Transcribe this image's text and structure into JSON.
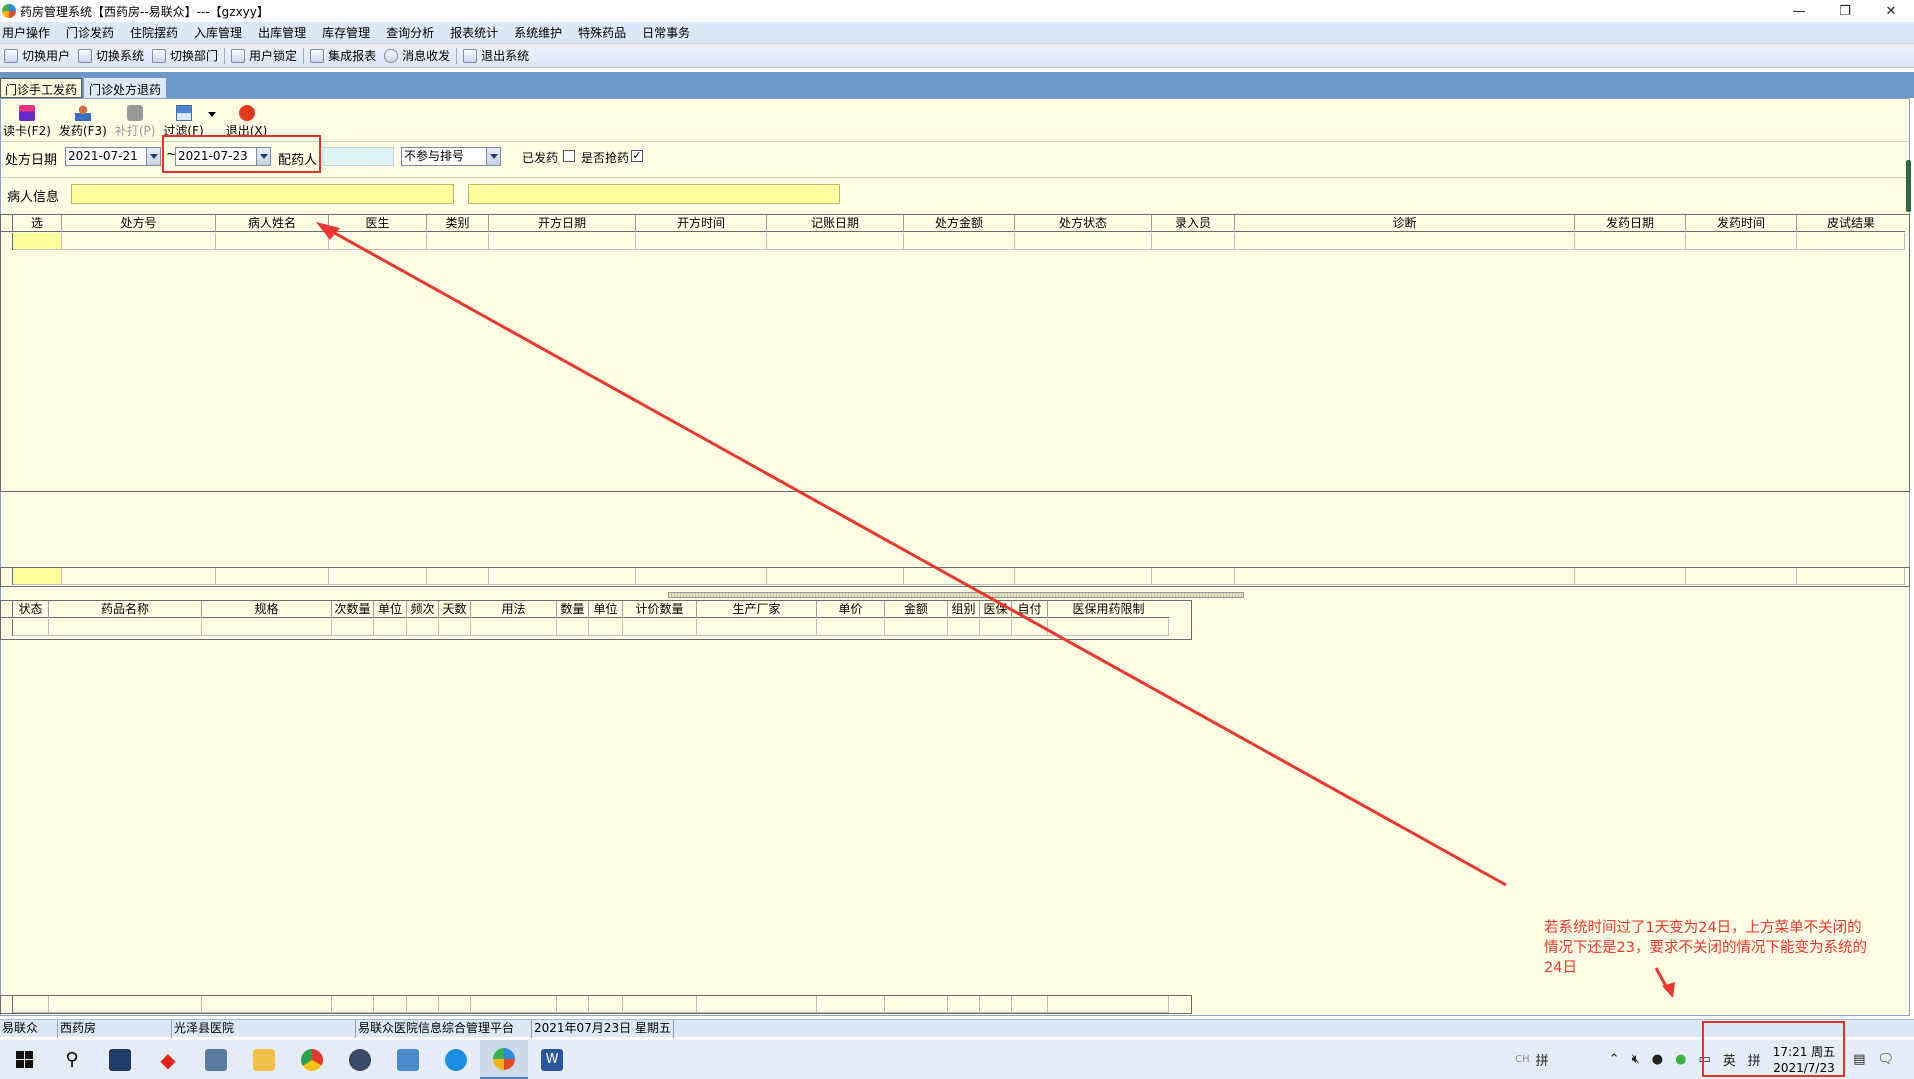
{
  "window": {
    "title": "药房管理系统【西药房--易联众】---【gzxyy】",
    "minimize_icon": "minimize-icon",
    "restore_icon": "restore-icon",
    "close_icon": "close-icon"
  },
  "menu": [
    "用户操作",
    "门诊发药",
    "住院摆药",
    "入库管理",
    "出库管理",
    "库存管理",
    "查询分析",
    "报表统计",
    "系统维护",
    "特殊药品",
    "日常事务"
  ],
  "toolbar": [
    "切换用户",
    "切换系统",
    "切换部门",
    "用户锁定",
    "集成报表",
    "消息收发",
    "退出系统"
  ],
  "tabs": [
    "门诊手工发药",
    "门诊处方退药"
  ],
  "actions": {
    "read_card": "读卡(F2)",
    "dispense": "发药(F3)",
    "reprint": "补打(P)",
    "filter": "过滤(F)",
    "exit": "退出(X)"
  },
  "filter": {
    "date_label": "处方日期",
    "date_from": "2021-07-21",
    "tilde": "~",
    "date_to": "2021-07-23",
    "pharmacist_label": "配药人",
    "queue_select": "不参与排号",
    "dispensed_label": "已发药",
    "dispensed_checked": false,
    "grab_label": "是否抢药",
    "grab_checked": true
  },
  "patient": {
    "label": "病人信息"
  },
  "rx_grid": {
    "columns": [
      "选",
      "处方号",
      "病人姓名",
      "医生",
      "类别",
      "开方日期",
      "开方时间",
      "记账日期",
      "处方金额",
      "处方状态",
      "录入员",
      "诊断",
      "发药日期",
      "发药时间",
      "皮试结果"
    ]
  },
  "drug_grid": {
    "columns": [
      "状态",
      "药品名称",
      "规格",
      "次数量",
      "单位",
      "频次",
      "天数",
      "用法",
      "数量",
      "单位",
      "计价数量",
      "生产厂家",
      "单价",
      "金额",
      "组别",
      "医保",
      "自付",
      "医保用药限制"
    ]
  },
  "annotation": {
    "line1": "若系统时间过了1天变为24日，上方菜单不关闭的",
    "line2": "情况下还是23，要求不关闭的情况下能变为系统的",
    "line3": "24日",
    "color": "#e5392f"
  },
  "status": [
    "易联众",
    "西药房",
    "光泽县医院",
    "易联众医院信息综合管理平台",
    "2021年07月23日 星期五"
  ],
  "taskbar": {
    "ime_short": "CH",
    "ime": "拼",
    "lang": "英",
    "ime2": "拼",
    "time": "17:21 周五",
    "date": "2021/7/23"
  }
}
